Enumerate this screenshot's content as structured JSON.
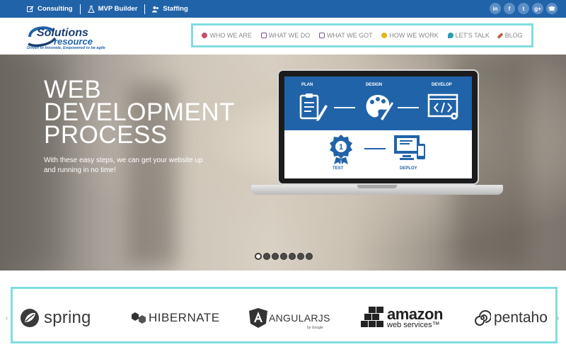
{
  "topbar": {
    "links": [
      {
        "label": "Consulting",
        "icon": "edit-icon"
      },
      {
        "label": "MVP Builder",
        "icon": "flask-icon"
      },
      {
        "label": "Staffing",
        "icon": "users-icon"
      }
    ],
    "social": [
      {
        "glyph": "in",
        "icon": "linkedin-icon"
      },
      {
        "glyph": "f",
        "icon": "facebook-icon"
      },
      {
        "glyph": "t",
        "icon": "twitter-icon"
      },
      {
        "glyph": "g+",
        "icon": "google-plus-icon"
      },
      {
        "glyph": "☎",
        "icon": "phone-icon"
      }
    ],
    "bg_color": "#2163a8"
  },
  "header": {
    "logo_text_1": "Solutions",
    "logo_text_2": "resource",
    "tagline": "Driven to Innovate, Empowered to be agile",
    "nav": [
      {
        "label": "WHO WE ARE",
        "icon": "person-icon",
        "icon_color": "#c94d6a"
      },
      {
        "label": "WHAT WE DO",
        "icon": "monitor-icon",
        "icon_color": "#7a4f9c"
      },
      {
        "label": "WHAT WE GOT",
        "icon": "monitor-icon",
        "icon_color": "#7a4f9c"
      },
      {
        "label": "HOW WE WORK",
        "icon": "sun-icon",
        "icon_color": "#e8b21a"
      },
      {
        "label": "LET'S TALK",
        "icon": "chat-icon",
        "icon_color": "#2a9fb4"
      },
      {
        "label": "BLOG",
        "icon": "pencil-icon",
        "icon_color": "#c0604a"
      }
    ]
  },
  "hero": {
    "title_lines": [
      "WEB",
      "DEVELOPMENT",
      "PROCESS"
    ],
    "subtitle": "With these easy steps, we can get your website up and running in no time!",
    "process": {
      "plan": "PLAN",
      "design": "DESIGN",
      "develop": "DEVELOP",
      "test": "TEST",
      "deploy": "DEPLOY"
    },
    "slide_count": 7,
    "active_slide": 1
  },
  "partners": {
    "prev": "‹",
    "next": "›",
    "items": [
      {
        "name": "spring"
      },
      {
        "name": "HIBERNATE"
      },
      {
        "name": "ANGULARJS",
        "by": "by Google"
      },
      {
        "name": "amazon",
        "sub": "web services™"
      },
      {
        "name": "pentaho"
      }
    ]
  }
}
